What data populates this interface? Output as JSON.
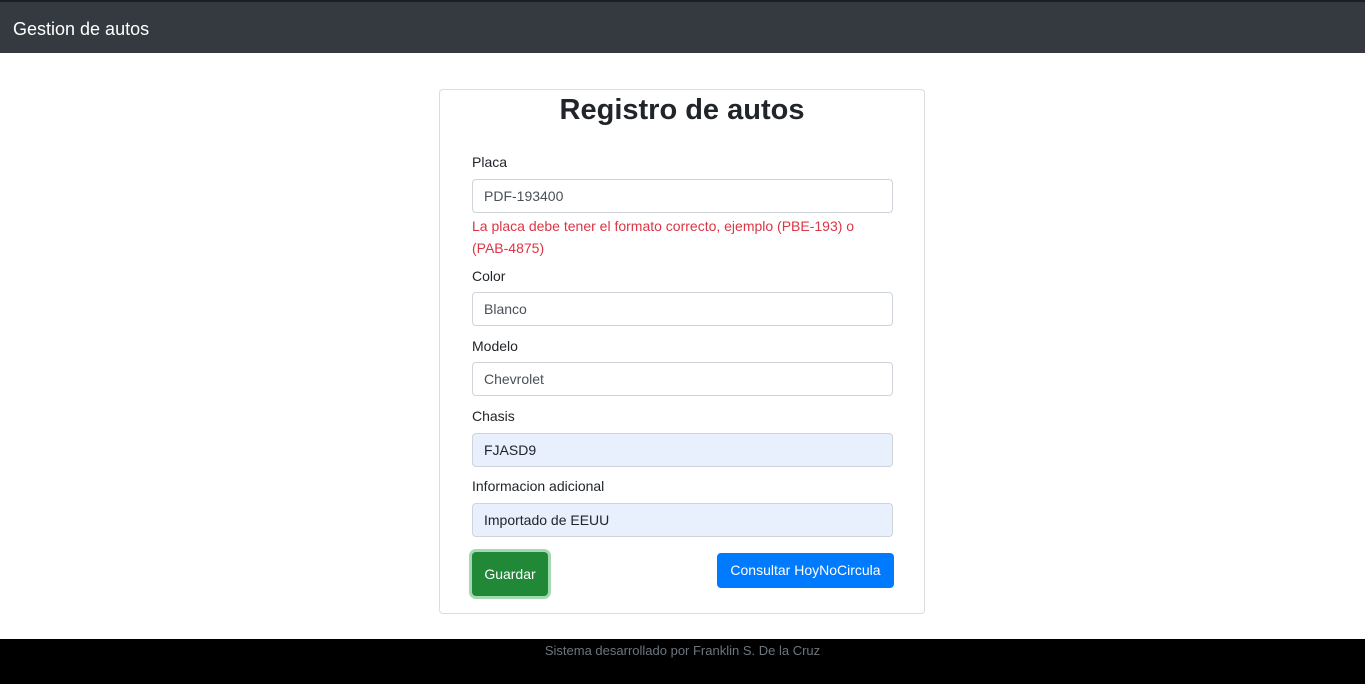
{
  "navbar": {
    "brand": "Gestion de autos"
  },
  "form": {
    "title": "Registro de autos",
    "placa": {
      "label": "Placa",
      "value": "PDF-193400"
    },
    "placa_error": "La placa debe tener el formato correcto, ejemplo (PBE-193) o (PAB-4875)",
    "color": {
      "label": "Color",
      "value": "Blanco"
    },
    "modelo": {
      "label": "Modelo",
      "value": "Chevrolet"
    },
    "chasis": {
      "label": "Chasis",
      "value": "FJASD9"
    },
    "info": {
      "label": "Informacion adicional",
      "value": "Importado de EEUU"
    },
    "save_label": "Guardar",
    "query_label": "Consultar HoyNoCircula"
  },
  "footer": {
    "text": "Sistema desarrollado por Franklin S. De la Cruz"
  },
  "colors": {
    "navbar": "#343a40",
    "error": "#dc3545",
    "save_button": "#218838",
    "query_button": "#007bff",
    "footer": "#000000"
  }
}
